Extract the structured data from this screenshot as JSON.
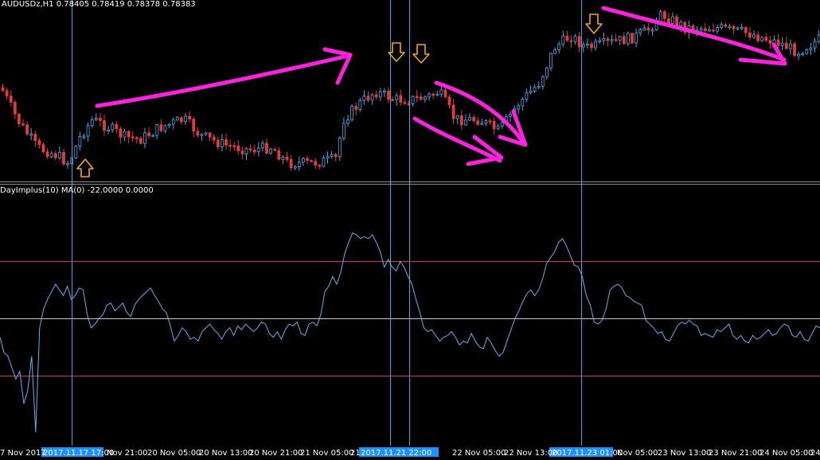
{
  "main_chart": {
    "header": "AUDUSDz,H1  0.78405 0.78419 0.78378 0.78383"
  },
  "indicator": {
    "header": "DayImplus(10) MA(0) -22.0000 0.0000",
    "levels": [
      30,
      0,
      -30
    ],
    "values": [
      -10,
      -18,
      -20,
      -26,
      -32,
      -28,
      -45,
      -38,
      -20,
      -60,
      -5,
      5,
      10,
      14,
      18,
      15,
      12,
      17,
      10,
      12,
      16,
      15,
      2,
      -5,
      -3,
      0,
      2,
      7,
      8,
      4,
      6,
      8,
      3,
      1,
      7,
      10,
      12,
      14,
      16,
      12,
      9,
      5,
      3,
      -4,
      -12,
      -9,
      -5,
      -7,
      -11,
      -10,
      -12,
      -7,
      -5,
      -3,
      -6,
      -8,
      -11,
      -7,
      -5,
      -9,
      -4,
      -6,
      -3,
      -5,
      -7,
      -5,
      -2,
      -3,
      -8,
      -10,
      -7,
      -11,
      -6,
      -3,
      -4,
      -2,
      -8,
      -9,
      -3,
      -2,
      -4,
      2,
      14,
      17,
      22,
      18,
      24,
      34,
      40,
      45,
      44,
      42,
      43,
      42,
      44,
      40,
      35,
      27,
      31,
      27,
      25,
      30,
      27,
      22,
      18,
      10,
      3,
      -5,
      -7,
      -6,
      -9,
      -12,
      -10,
      -9,
      -7,
      -10,
      -14,
      -12,
      -13,
      -8,
      -12,
      -15,
      -16,
      -10,
      -13,
      -17,
      -20,
      -18,
      -12,
      -6,
      0,
      4,
      9,
      13,
      15,
      12,
      15,
      21,
      29,
      32,
      35,
      40,
      42,
      38,
      33,
      28,
      27,
      22,
      12,
      7,
      -2,
      -3,
      -1,
      5,
      15,
      17,
      18,
      16,
      12,
      11,
      9,
      8,
      7,
      -1,
      -3,
      -5,
      -8,
      -7,
      -11,
      -12,
      -8,
      -4,
      -2,
      -3,
      -1,
      -3,
      -4,
      -9,
      -8,
      -9,
      -10,
      -6,
      -7,
      -5,
      -3,
      -9,
      -11,
      -9,
      -12,
      -13,
      -9,
      -11,
      -10,
      -8,
      -6,
      -9,
      -8,
      -5,
      -3,
      -4,
      -9,
      -10,
      -7,
      -11,
      -12,
      -8,
      -4,
      -5
    ],
    "value_range": [
      -65,
      65
    ]
  },
  "time_axis": {
    "labels": [
      "7 Nov 2017",
      "2017.11.17 17:00",
      "Nov 21:00",
      "20 Nov 05:00",
      "20 Nov 13:00",
      "20 Nov 21:00",
      "21 Nov 05:00",
      "21",
      "2017.11.21 22:00",
      "22 Nov 05:00",
      "22 Nov 13:00",
      "2017.11.23 01:00",
      "Nov 05:00",
      "23 Nov 13:00",
      "23 Nov 21:00",
      "24 Nov 05:00",
      "24"
    ],
    "highlighted": [
      "2017.11.17 17:00",
      "2017.11.21 22:00",
      "2017.11.23 01:00"
    ]
  },
  "colors": {
    "background": "#000000",
    "bull": "#4aa8e8",
    "bear": "#e03c3c",
    "indicator_line": "#5ab4f0",
    "level_line": "#e0304a",
    "zero_line": "#c8c8c8",
    "vline": "#3aa8e8",
    "arrow_orange": "#f5a623",
    "annotation": "#ff22dd"
  },
  "annotations": {
    "up_arrow_count": 1,
    "down_arrow_count": 3,
    "drawn_arrow_count": 4
  }
}
